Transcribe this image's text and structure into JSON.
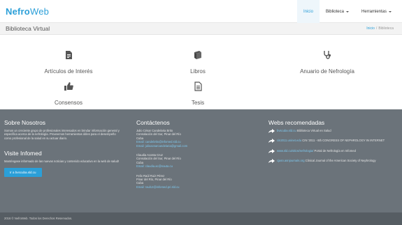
{
  "brand": {
    "part1": "Nefro",
    "part2": "Web"
  },
  "nav": {
    "items": [
      {
        "label": "Inicio",
        "active": true,
        "dropdown": false
      },
      {
        "label": "Biblioteca",
        "active": false,
        "dropdown": true
      },
      {
        "label": "Herramientas",
        "active": false,
        "dropdown": true
      }
    ]
  },
  "titlebar": {
    "title": "Biblioteca Virtual",
    "breadcrumb": {
      "home": "Inicio",
      "separator": "/",
      "current": "Biblioteca"
    }
  },
  "resources": [
    {
      "label": "Artículos de Interés",
      "icon": "document-icon"
    },
    {
      "label": "Libros",
      "icon": "book-icon"
    },
    {
      "label": "Anuario de Nefrología",
      "icon": "stethoscope-icon"
    },
    {
      "label": "Consensos",
      "icon": "thumbs-up-icon"
    },
    {
      "label": "Tesis",
      "icon": "file-text-icon"
    }
  ],
  "about": {
    "heading": "Sobre Nosotros",
    "text": "Somos un creciente grupo de profesionales interesados en brindar información general y específica acerca de la nefrología. Proveemos herramientas útiles para el desempeño como profesional de la salud en su actuar diario."
  },
  "visit": {
    "heading": "Visite Infomed",
    "text": "Manténgase informado de las nuevas noticias y contenido educativo en la web de salud!",
    "button": "Ir a bvscuba.sld.cu"
  },
  "contact": {
    "heading": "Contáctenos",
    "people": [
      {
        "name": "Julio César Candelaria Brito",
        "l1": "Consolación del Sur, Pinar del Río",
        "l2": "Cuba",
        "emails": [
          "Email: candebrito@infomed.sld.cu",
          "Email: julioacsarcandelaria@gmail.com"
        ]
      },
      {
        "name": "Claudia Acosta Cruz",
        "l1": "Consolación del Sur, Pinar del Río",
        "l2": "Cuba",
        "emails": [
          "Email: claudia.ac@nauta.cu"
        ]
      },
      {
        "name": "Felix Raúl Ruiz Pérez",
        "l1": "Pinar del Río, Pinar del Río",
        "l2": "Cuba",
        "emails": [
          "Email: raul12@infomed.pri.sld.cu"
        ]
      }
    ]
  },
  "webs": {
    "heading": "Webs recomendadas",
    "items": [
      {
        "link": "bvscuba.sld.cu",
        "text": "Biblioteca Virtual en Salud"
      },
      {
        "link": "cin2011.uninet.edu",
        "text": "CIN '2011 - 6th CONGRESS OF NEPHROLOGY IN INTERNET"
      },
      {
        "link": "www.sld.cu/sitios/nefrologia/",
        "text": "Portal de Nefrología en Infomed"
      },
      {
        "link": "cjasn.asnjournals.org",
        "text": "Clinical Journal of the American Society of Nephrology"
      }
    ]
  },
  "footer": {
    "copyright": "2016 © NefroWeb. Todos los Derechos Reservados."
  }
}
